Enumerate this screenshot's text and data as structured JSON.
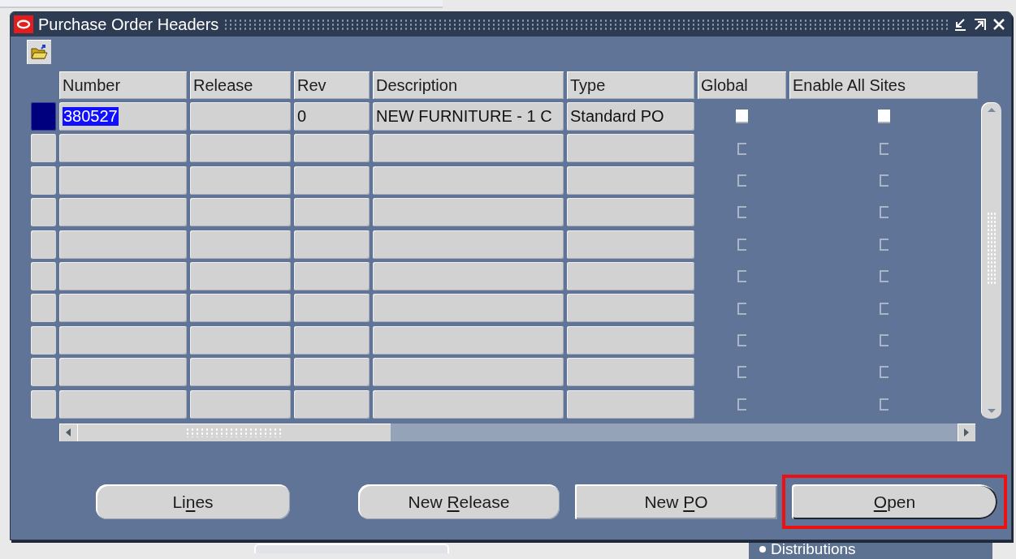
{
  "window": {
    "title": "Purchase Order Headers"
  },
  "table": {
    "columns": [
      "Number",
      "Release",
      "Rev",
      "Description",
      "Type",
      "Global",
      "Enable All Sites"
    ],
    "rows": [
      {
        "kind": "record",
        "selected": true,
        "number": "380527",
        "rev": "0",
        "description": "NEW FURNITURE - 1 C",
        "type": "Standard PO",
        "global": false,
        "enable_all_sites": false
      },
      {
        "kind": "blank",
        "selected": false,
        "global": false,
        "enable_all_sites": false
      },
      {
        "kind": "blank",
        "selected": false,
        "global": false,
        "enable_all_sites": false
      },
      {
        "kind": "blank",
        "selected": false,
        "global": false,
        "enable_all_sites": false
      },
      {
        "kind": "blank",
        "selected": false,
        "global": false,
        "enable_all_sites": false
      },
      {
        "kind": "blank",
        "selected": false,
        "global": false,
        "enable_all_sites": false
      },
      {
        "kind": "blank",
        "selected": false,
        "global": false,
        "enable_all_sites": false
      },
      {
        "kind": "blank",
        "selected": false,
        "global": false,
        "enable_all_sites": false
      },
      {
        "kind": "blank",
        "selected": false,
        "global": false,
        "enable_all_sites": false
      },
      {
        "kind": "blank",
        "selected": false,
        "global": false,
        "enable_all_sites": false
      }
    ]
  },
  "buttons": [
    {
      "kind": "round",
      "label_before": "Li",
      "access_key": "n",
      "label_after": "es",
      "highlighted": false
    },
    {
      "kind": "round",
      "label_before": "New ",
      "access_key": "R",
      "label_after": "elease",
      "highlighted": false
    },
    {
      "kind": "square",
      "label_before": "New ",
      "access_key": "P",
      "label_after": "O",
      "highlighted": false
    },
    {
      "kind": "default",
      "access_key": "O",
      "label_after": "pen",
      "highlighted": true
    }
  ],
  "background": {
    "item": "Distributions"
  }
}
